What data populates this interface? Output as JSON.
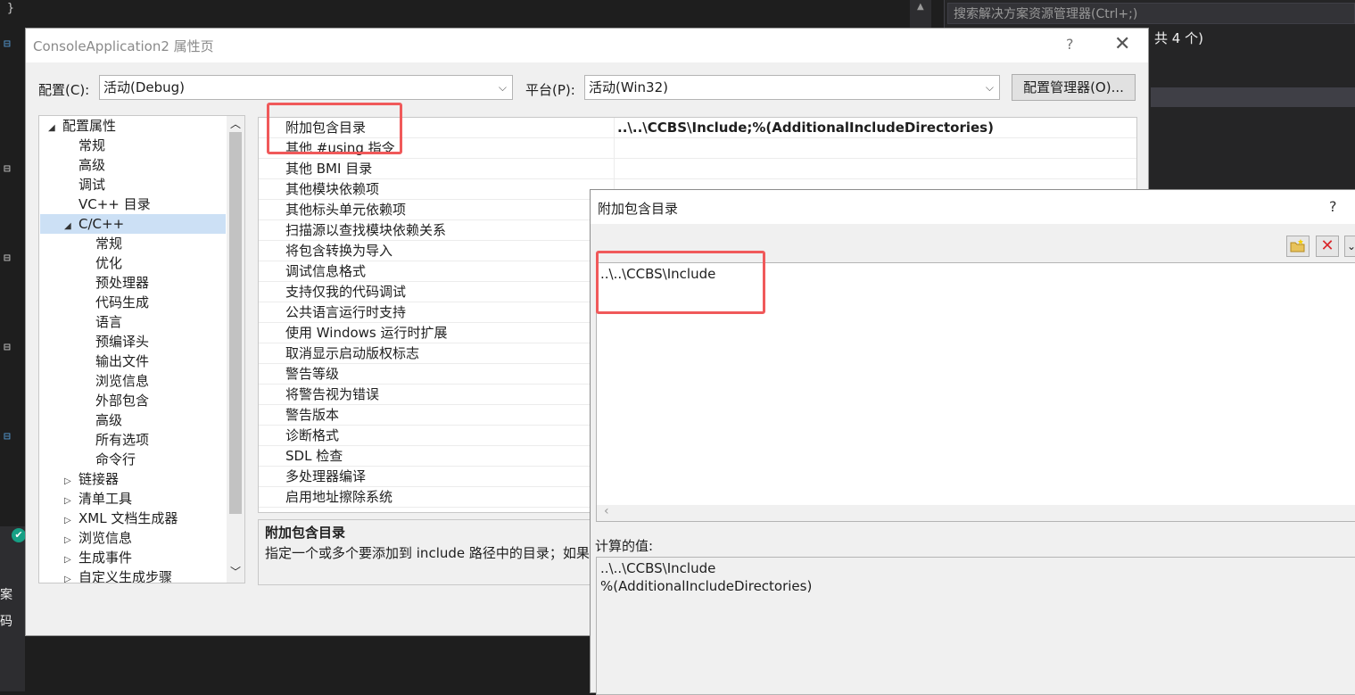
{
  "ide": {
    "solution_search_placeholder": "搜索解决方案资源管理器(Ctrl+;)",
    "solution_count": "共 4 个)",
    "bottom_label_1": "案",
    "bottom_label_2": "码"
  },
  "dialog": {
    "title": "ConsoleApplication2 属性页",
    "help": "?",
    "close": "✕",
    "config_label": "配置(C):",
    "config_value": "活动(Debug)",
    "platform_label": "平台(P):",
    "platform_value": "活动(Win32)",
    "config_manager_button": "配置管理器(O)..."
  },
  "tree": {
    "items": [
      {
        "label": "配置属性",
        "twisty": "◢"
      },
      {
        "label": "常规"
      },
      {
        "label": "高级"
      },
      {
        "label": "调试"
      },
      {
        "label": "VC++ 目录"
      },
      {
        "label": "C/C++",
        "twisty": "◢"
      },
      {
        "label": "常规"
      },
      {
        "label": "优化"
      },
      {
        "label": "预处理器"
      },
      {
        "label": "代码生成"
      },
      {
        "label": "语言"
      },
      {
        "label": "预编译头"
      },
      {
        "label": "输出文件"
      },
      {
        "label": "浏览信息"
      },
      {
        "label": "外部包含"
      },
      {
        "label": "高级"
      },
      {
        "label": "所有选项"
      },
      {
        "label": "命令行"
      },
      {
        "label": "链接器",
        "twisty": "▷"
      },
      {
        "label": "清单工具",
        "twisty": "▷"
      },
      {
        "label": "XML 文档生成器",
        "twisty": "▷"
      },
      {
        "label": "浏览信息",
        "twisty": "▷"
      },
      {
        "label": "生成事件",
        "twisty": "▷"
      },
      {
        "label": "自定义生成步骤",
        "twisty": "▷"
      }
    ],
    "scroll_up": "︿",
    "scroll_down": "﹀"
  },
  "grid": {
    "rows": [
      {
        "name": "附加包含目录",
        "value": "..\\..\\CCBS\\Include;%(AdditionalIncludeDirectories)"
      },
      {
        "name": "其他 #using 指令",
        "value": ""
      },
      {
        "name": "其他 BMI 目录",
        "value": ""
      },
      {
        "name": "其他模块依赖项",
        "value": ""
      },
      {
        "name": "其他标头单元依赖项",
        "value": ""
      },
      {
        "name": "扫描源以查找模块依赖关系",
        "value": ""
      },
      {
        "name": "将包含转换为导入",
        "value": ""
      },
      {
        "name": "调试信息格式",
        "value": ""
      },
      {
        "name": "支持仅我的代码调试",
        "value": ""
      },
      {
        "name": "公共语言运行时支持",
        "value": ""
      },
      {
        "name": "使用 Windows 运行时扩展",
        "value": ""
      },
      {
        "name": "取消显示启动版权标志",
        "value": ""
      },
      {
        "name": "警告等级",
        "value": ""
      },
      {
        "name": "将警告视为错误",
        "value": ""
      },
      {
        "name": "警告版本",
        "value": ""
      },
      {
        "name": "诊断格式",
        "value": ""
      },
      {
        "name": "SDL 检查",
        "value": ""
      },
      {
        "name": "多处理器编译",
        "value": ""
      },
      {
        "name": "启用地址擦除系统",
        "value": ""
      }
    ]
  },
  "description": {
    "title": "附加包含目录",
    "text": "指定一个或多个要添加到 include 路径中的目录；如果有"
  },
  "include_dialog": {
    "title": "附加包含目录",
    "help": "?",
    "entry": "..\\..\\CCBS\\Include",
    "scroll_left": "‹",
    "calc_label": "计算的值:",
    "calc_lines": [
      "..\\..\\CCBS\\Include",
      "%(AdditionalIncludeDirectories)"
    ]
  },
  "colors": {
    "highlight": "#f0595a",
    "selection": "#cce0f5",
    "delete_icon": "#d9262b"
  }
}
